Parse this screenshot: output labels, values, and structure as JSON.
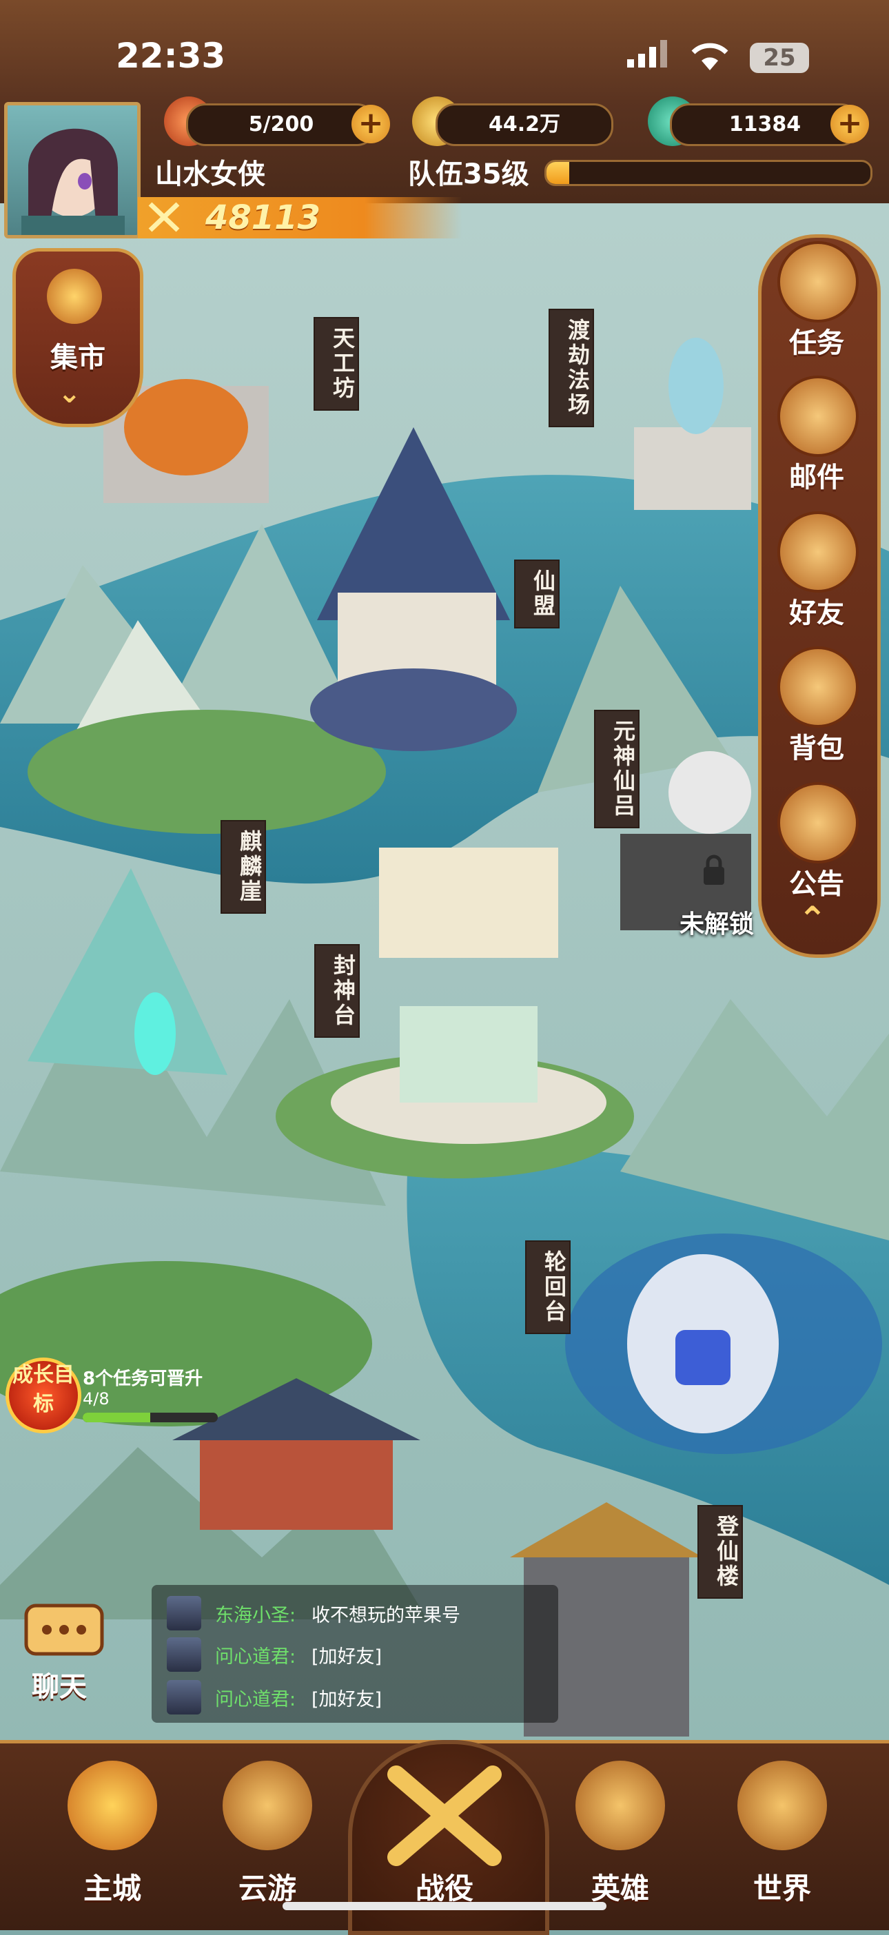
{
  "status_bar": {
    "time": "22:33",
    "battery": "25"
  },
  "header": {
    "stamina": "5/200",
    "gold": "44.2万",
    "jade": "11384",
    "player_name": "山水女侠",
    "team_level": "队伍35级",
    "team_level_progress": 0.07,
    "power": "48113"
  },
  "market": {
    "label": "集市"
  },
  "right_menu": [
    {
      "label": "任务",
      "icon": "scroll-icon"
    },
    {
      "label": "邮件",
      "icon": "envelope-icon"
    },
    {
      "label": "好友",
      "icon": "handshake-icon"
    },
    {
      "label": "背包",
      "icon": "bag-icon"
    },
    {
      "label": "公告",
      "icon": "notice-icon"
    }
  ],
  "buildings": {
    "tiangongfang": "天工坊",
    "dujiefachang": "渡劫法场",
    "xianmeng": "仙盟",
    "yuanshenxianlv": "元神仙吕",
    "qilinya": "麒麟崖",
    "fengshentai": "封神台",
    "lunhuitai": "轮回台",
    "dengxianlou": "登仙楼"
  },
  "locked_label": "未解锁",
  "goal": {
    "badge": "成长目标",
    "text": "8个任务可晋升",
    "count": "4/8",
    "progress": 0.5
  },
  "chat": {
    "label": "聊天",
    "messages": [
      {
        "name": "东海小圣:",
        "text": "收不想玩的苹果号"
      },
      {
        "name": "问心道君:",
        "text": "[加好友]"
      },
      {
        "name": "问心道君:",
        "text": "[加好友]"
      }
    ]
  },
  "bottom_nav": {
    "main_city": "主城",
    "travel": "云游",
    "battle": "战役",
    "heroes": "英雄",
    "world": "世界"
  }
}
